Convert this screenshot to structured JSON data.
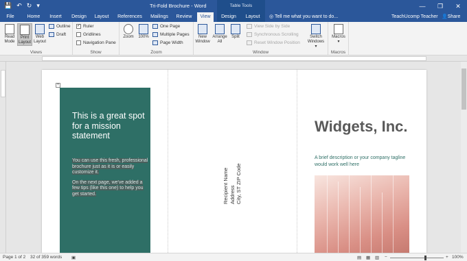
{
  "window": {
    "title": "Tri-Fold Brochure - Word",
    "context_group": "Table Tools",
    "controls": [
      "—",
      "❐",
      "✕"
    ]
  },
  "qat": {
    "save": "💾",
    "undo": "↶",
    "redo": "↻",
    "customize": "▾"
  },
  "tabs": [
    {
      "label": "File"
    },
    {
      "label": "Home"
    },
    {
      "label": "Insert"
    },
    {
      "label": "Design"
    },
    {
      "label": "Layout"
    },
    {
      "label": "References"
    },
    {
      "label": "Mailings"
    },
    {
      "label": "Review"
    },
    {
      "label": "View"
    },
    {
      "label": "Design"
    },
    {
      "label": "Layout"
    }
  ],
  "active_tab": "View",
  "tell_me": "Tell me what you want to do...",
  "user": "TeachUcomp Teacher",
  "share": "Share",
  "ribbon": {
    "views": {
      "label": "Views",
      "read_mode": "Read Mode",
      "print_layout": "Print Layout",
      "web_layout": "Web Layout",
      "outline": "Outline",
      "draft": "Draft"
    },
    "show": {
      "label": "Show",
      "ruler": "Ruler",
      "ruler_checked": true,
      "gridlines": "Gridlines",
      "nav_pane": "Navigation Pane"
    },
    "zoom": {
      "label": "Zoom",
      "zoom": "Zoom",
      "hundred": "100%",
      "one_page": "One Page",
      "multiple_pages": "Multiple Pages",
      "page_width": "Page Width"
    },
    "window": {
      "label": "Window",
      "new_window": "New Window",
      "arrange_all": "Arrange All",
      "split": "Split",
      "view_side": "View Side by Side",
      "sync_scroll": "Synchronous Scrolling",
      "reset_pos": "Reset Window Position",
      "switch_windows": "Switch Windows ▾"
    },
    "macros": {
      "label": "Macros",
      "macros": "Macros ▾"
    }
  },
  "document": {
    "mission_title": "This is a great spot for a mission statement",
    "mission_p1": "You can use this fresh, professional brochure just as it is or easily customize it.",
    "mission_p2": "On the next page, we've added a few tips (like this one) to help you get started.",
    "address_lines": [
      "Recipient Name",
      "Address",
      "City, ST  ZIP Code"
    ],
    "company": "Widgets, Inc.",
    "tagline": "A brief description or your company tagline would work well here"
  },
  "status": {
    "page": "Page 1 of 2",
    "words": "32 of 359 words",
    "zoom": "100%"
  },
  "colors": {
    "accent": "#2b579a",
    "teal": "#2e6f66"
  }
}
